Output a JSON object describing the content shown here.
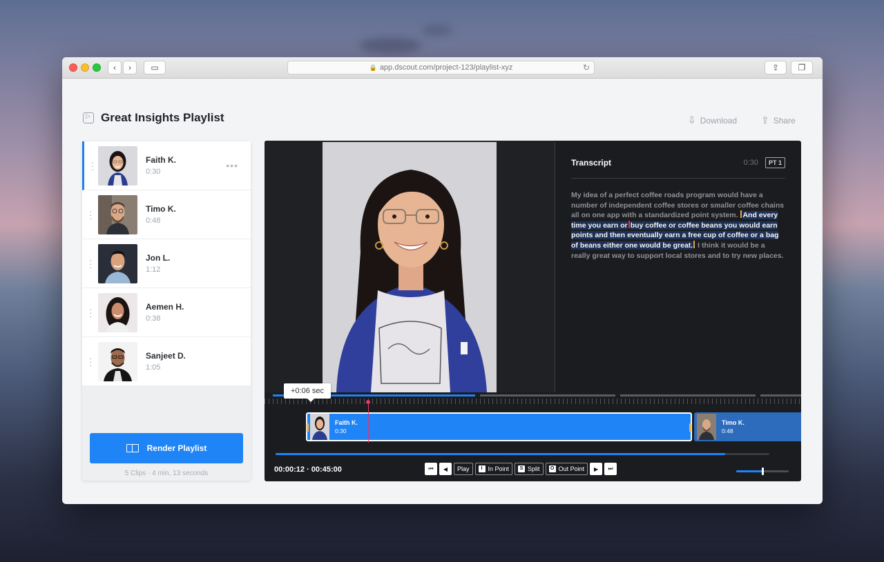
{
  "browser": {
    "url": "app.dscout.com/project-123/playlist-xyz"
  },
  "header": {
    "title": "Great Insights Playlist",
    "download_label": "Download",
    "share_label": "Share"
  },
  "sidebar": {
    "clips": [
      {
        "name": "Faith K.",
        "duration": "0:30",
        "active": true
      },
      {
        "name": "Timo K.",
        "duration": "0:48",
        "active": false
      },
      {
        "name": "Jon L.",
        "duration": "1:12",
        "active": false
      },
      {
        "name": "Aemen H.",
        "duration": "0:38",
        "active": false
      },
      {
        "name": "Sanjeet D.",
        "duration": "1:05",
        "active": false
      }
    ],
    "render_label": "Render Playlist",
    "summary": "5 Clips · 4 min, 13 seconds"
  },
  "transcript": {
    "title": "Transcript",
    "time": "0:30",
    "badge": "PT 1",
    "text_before": "My idea of a perfect coffee roads program would have a number of independent coffee stores or smaller coffee chains all on one app with a standardized point system.",
    "text_highlight_a": "And every time you earn or",
    "text_highlight_b": "buy coffee or coffee beans you would earn points and then eventually earn a free cup of coffee or a bag of beans either one would be great.",
    "text_after": "I think it would be a really great way to support local stores and to try new places."
  },
  "timeline": {
    "tooltip": "+0:06 sec",
    "clips": [
      {
        "name": "Faith K.",
        "duration": "0:30"
      },
      {
        "name": "Timo K.",
        "duration": "0:48"
      }
    ],
    "progress": 0.91,
    "volume": 0.5
  },
  "controls": {
    "timecode": "00:00:12 · 00:45:00",
    "play_label": "Play",
    "in_point_label": "In Point",
    "in_point_key": "I",
    "split_label": "Split",
    "split_key": "S",
    "out_point_label": "Out Point",
    "out_point_key": "O"
  },
  "colors": {
    "accent": "#1f84f5",
    "playhead": "#e8356a",
    "handle": "#f0b34e"
  }
}
